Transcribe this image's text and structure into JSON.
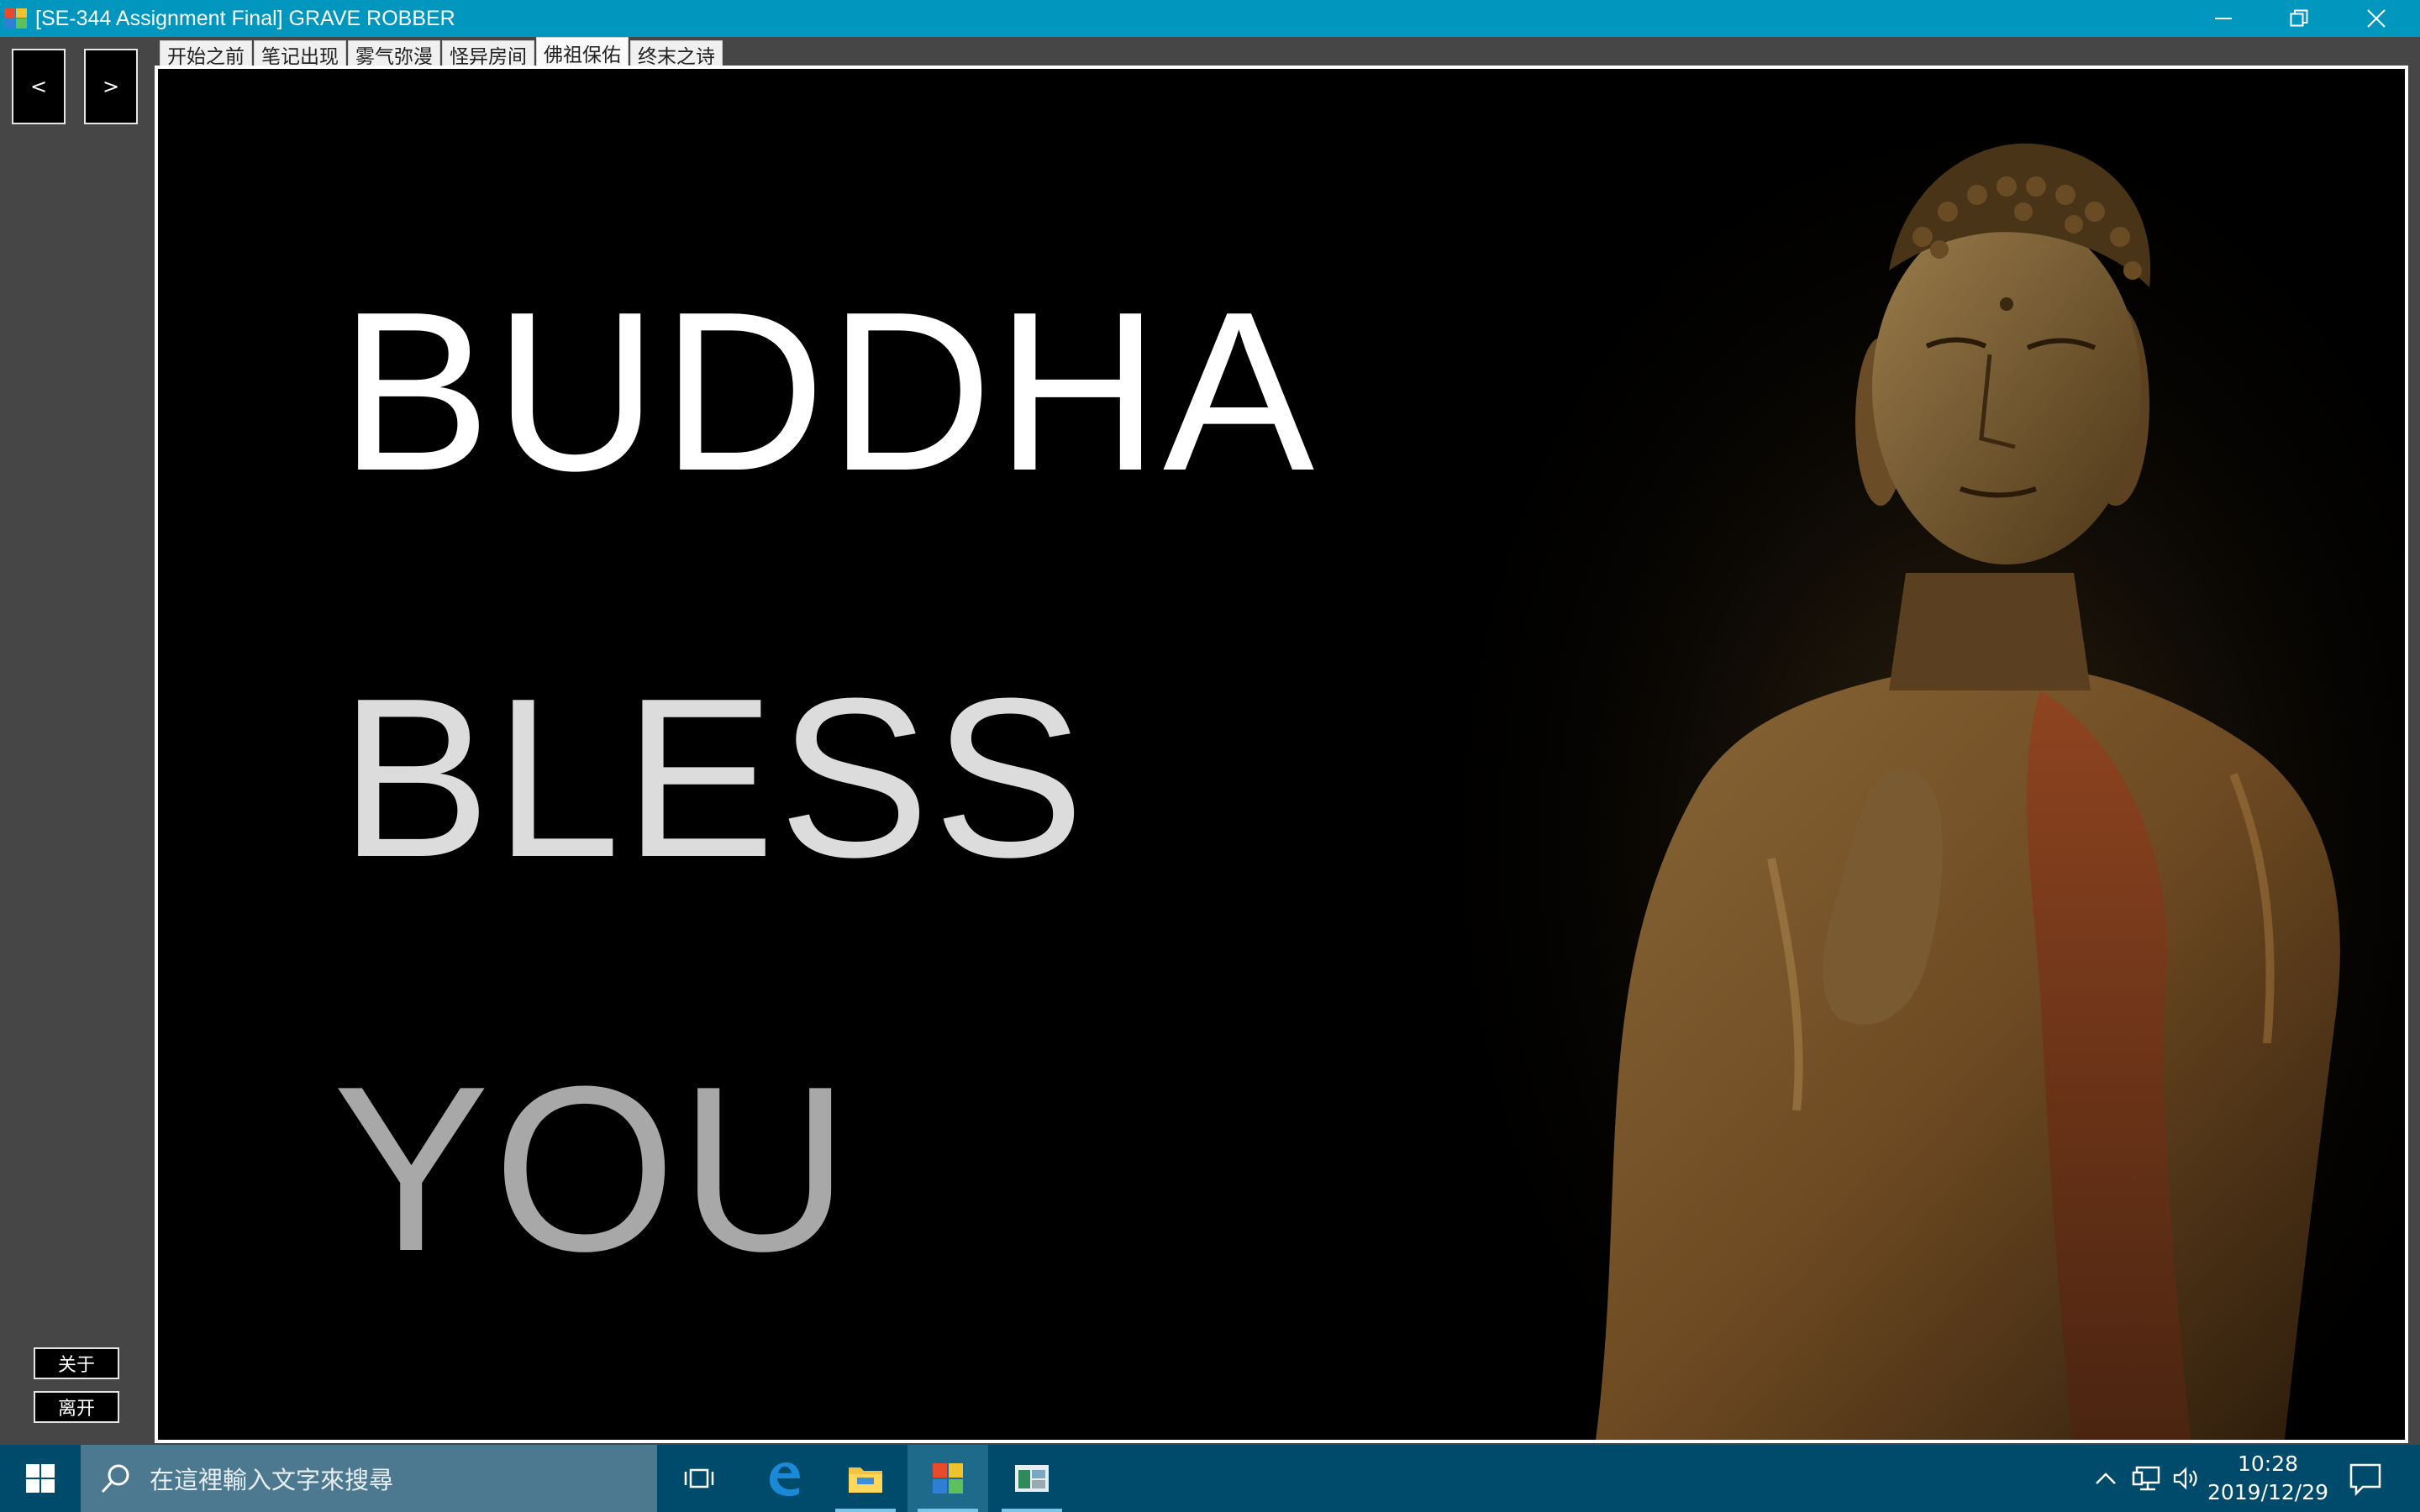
{
  "window": {
    "title": "[SE-344 Assignment Final] GRAVE ROBBER",
    "app_icon": "app-icon",
    "controls": [
      "minimize-icon",
      "restore-icon",
      "close-icon"
    ]
  },
  "sidebar": {
    "prev_label": "<",
    "next_label": ">",
    "about_label": "关于",
    "exit_label": "离开"
  },
  "tabs": [
    {
      "label": "开始之前",
      "active": false
    },
    {
      "label": "笔记出现",
      "active": false
    },
    {
      "label": "雾气弥漫",
      "active": false
    },
    {
      "label": "怪异房间",
      "active": false
    },
    {
      "label": "佛祖保佑",
      "active": true
    },
    {
      "label": "终末之诗",
      "active": false
    }
  ],
  "content": {
    "line1": "BUDDHA",
    "line2": "BLESS",
    "line3": "YOU",
    "image": "buddha-statue"
  },
  "taskbar": {
    "search_placeholder": "在這裡輸入文字來搜尋",
    "pinned": [
      "task-view-icon",
      "edge-icon",
      "file-explorer-icon",
      "grave-robber-app-icon",
      "second-app-icon"
    ],
    "clock_time": "10:28",
    "clock_date": "2019/12/29"
  },
  "colors": {
    "titlebar": "#0096bd",
    "taskbar": "#004b6b",
    "search_box": "#4c7990",
    "client_bg": "#464646"
  }
}
